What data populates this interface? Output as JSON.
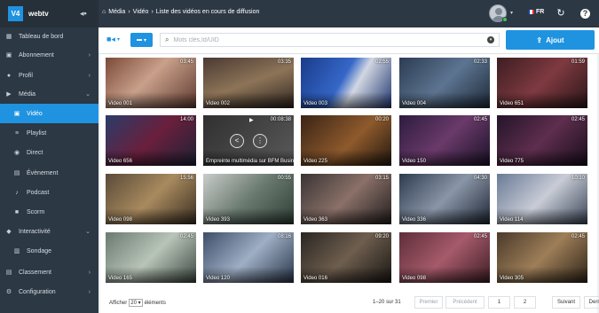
{
  "sidebar": {
    "logo": "V4",
    "brand": "webtv",
    "items": [
      {
        "label": "Tableau de bord",
        "icon": "▦"
      },
      {
        "label": "Abonnement",
        "icon": "▣",
        "chevron": "›"
      },
      {
        "label": "Profil",
        "icon": "●",
        "chevron": "›"
      },
      {
        "label": "Média",
        "icon": "▶",
        "chevron": "⌄"
      },
      {
        "label": "Vidéo",
        "icon": "▣"
      },
      {
        "label": "Playlist",
        "icon": "≡"
      },
      {
        "label": "Direct",
        "icon": "◉"
      },
      {
        "label": "Évènement",
        "icon": "▤"
      },
      {
        "label": "Podcast",
        "icon": "♪"
      },
      {
        "label": "Scorm",
        "icon": "■"
      },
      {
        "label": "Interactivité",
        "icon": "◆",
        "chevron": "⌄"
      },
      {
        "label": "Sondage",
        "icon": "▥"
      },
      {
        "label": "Classement",
        "icon": "▤",
        "chevron": "›"
      },
      {
        "label": "Configuration",
        "icon": "⚙",
        "chevron": "›"
      }
    ]
  },
  "topbar": {
    "home_icon": "⌂",
    "breadcrumb": [
      "Média",
      "Vidéo",
      "Liste des vidéos en cours de diffusion"
    ],
    "separator": "›",
    "lang": "FR",
    "flag_colors": [
      "#1f3f9a",
      "#ffffff",
      "#e0283a"
    ]
  },
  "toolbar": {
    "search_placeholder": "Mots clés,Id/UID",
    "add_label": "Ajout"
  },
  "videos": [
    {
      "title": "Video 001",
      "duration": "03:45",
      "bg": "linear-gradient(135deg,#7a4a38,#c9a08a 45%,#5e3a30)"
    },
    {
      "title": "Video 002",
      "duration": "03:35",
      "bg": "linear-gradient(160deg,#4a3a32,#8d7458 50%,#2e241e)"
    },
    {
      "title": "Video 003",
      "duration": "02:55",
      "bg": "linear-gradient(120deg,#1a3c8a,#3567c8 45%,#d2d7e2 60%,#243a72)"
    },
    {
      "title": "Video 004",
      "duration": "02:33",
      "bg": "linear-gradient(135deg,#2c3c52,#5d7491 50%,#1e2a38)"
    },
    {
      "title": "Video 651",
      "duration": "01:59",
      "bg": "linear-gradient(135deg,#3d1e22,#7e3a40 50%,#2a1518)"
    },
    {
      "title": "Video 656",
      "duration": "14:00",
      "bg": "linear-gradient(135deg,#2a3c6a,#6a1f3c 50%,#1d2236)"
    },
    {
      "title": "Empreinte multimédia sur BFM Business",
      "duration": "00:08:38",
      "bg": "linear-gradient(135deg,#4a4a4a,#8a8a8a)",
      "hover": true
    },
    {
      "title": "Video 225",
      "duration": "00:20",
      "bg": "linear-gradient(135deg,#3a2416,#8e5a2c 55%,#231810)"
    },
    {
      "title": "Video 150",
      "duration": "02:45",
      "bg": "linear-gradient(135deg,#2c1c3e,#6a3a6a 50%,#1a1228)"
    },
    {
      "title": "Video 775",
      "duration": "02:45",
      "bg": "linear-gradient(135deg,#24142a,#5e2e4e 50%,#180c1a)"
    },
    {
      "title": "Video 098",
      "duration": "15:56",
      "bg": "linear-gradient(135deg,#5a4a38,#a88a5e 50%,#3a2e22)"
    },
    {
      "title": "Video 393",
      "duration": "00:55",
      "bg": "linear-gradient(135deg,#c8ccc8,#6a7a70 50%,#2e3e36)"
    },
    {
      "title": "Video 363",
      "duration": "03:15",
      "bg": "linear-gradient(135deg,#3a3434,#8a7068 50%,#221e1e)"
    },
    {
      "title": "Video 336",
      "duration": "04:30",
      "bg": "linear-gradient(135deg,#2e3a4e,#8a96a8 50%,#1e2634)"
    },
    {
      "title": "Video 114",
      "duration": "10:10",
      "bg": "linear-gradient(135deg,#6a7a96,#c8ccd6 50%,#3a4658)"
    },
    {
      "title": "Video 165",
      "duration": "02:45",
      "bg": "linear-gradient(135deg,#6a7a70,#b8c4b8 50%,#3e4a42)"
    },
    {
      "title": "Video 120",
      "duration": "08:16",
      "bg": "linear-gradient(135deg,#3e4e6a,#9eaec4 50%,#2a364a)"
    },
    {
      "title": "Video 016",
      "duration": "09:20",
      "bg": "linear-gradient(135deg,#2a2622,#6e5e4e 50%,#1a1714)"
    },
    {
      "title": "Video 098",
      "duration": "02:45",
      "bg": "linear-gradient(135deg,#5e2e3a,#a65a6a 50%,#3e1e26)"
    },
    {
      "title": "Video 305",
      "duration": "02:45",
      "bg": "linear-gradient(135deg,#4a3a2a,#9e7e58 50%,#2e2418)"
    }
  ],
  "footer": {
    "show_label": "Afficher",
    "per_page": "20",
    "items_label": "éléments",
    "range": "1–20 sur 31",
    "pages": [
      "Premier",
      "Précédent",
      "1",
      "2",
      "Suivant",
      "Dernier"
    ]
  }
}
